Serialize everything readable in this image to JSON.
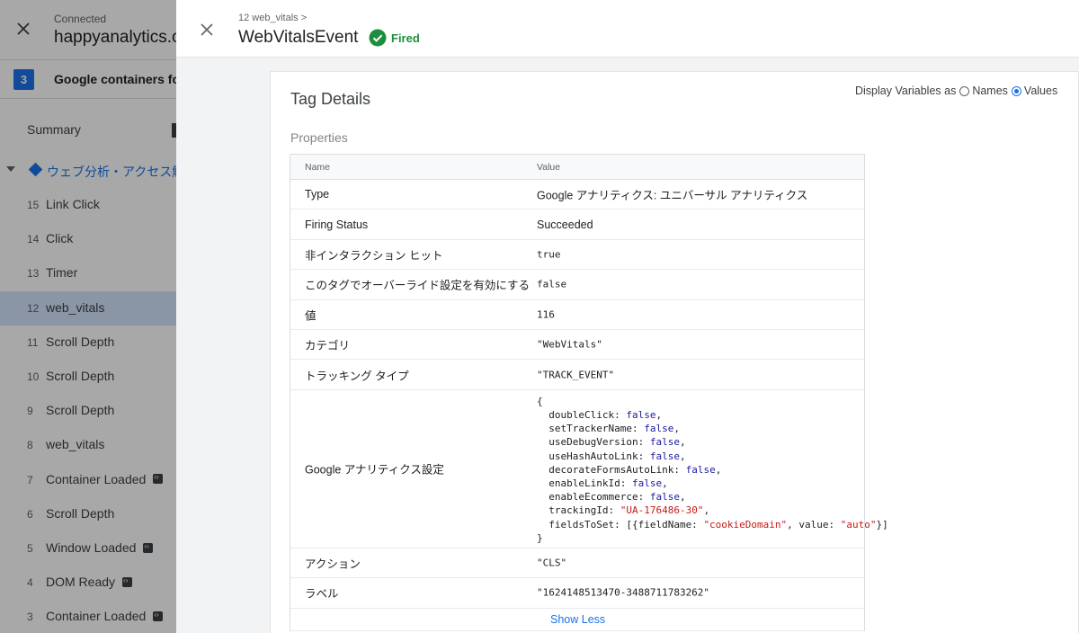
{
  "background": {
    "connected_label": "Connected",
    "site": "happyanalytics.c",
    "container_count": "3",
    "container_label": "Google containers fo",
    "summary_label": "Summary",
    "page_label": "ウェブ分析・アクセス解",
    "events": [
      {
        "num": "15",
        "label": "Link Click",
        "code": false,
        "selected": false
      },
      {
        "num": "14",
        "label": "Click",
        "code": false,
        "selected": false
      },
      {
        "num": "13",
        "label": "Timer",
        "code": false,
        "selected": false
      },
      {
        "num": "12",
        "label": "web_vitals",
        "code": false,
        "selected": true
      },
      {
        "num": "11",
        "label": "Scroll Depth",
        "code": false,
        "selected": false
      },
      {
        "num": "10",
        "label": "Scroll Depth",
        "code": false,
        "selected": false
      },
      {
        "num": "9",
        "label": "Scroll Depth",
        "code": false,
        "selected": false
      },
      {
        "num": "8",
        "label": "web_vitals",
        "code": false,
        "selected": false
      },
      {
        "num": "7",
        "label": "Container Loaded",
        "code": true,
        "selected": false
      },
      {
        "num": "6",
        "label": "Scroll Depth",
        "code": false,
        "selected": false
      },
      {
        "num": "5",
        "label": "Window Loaded",
        "code": true,
        "selected": false
      },
      {
        "num": "4",
        "label": "DOM Ready",
        "code": true,
        "selected": false
      },
      {
        "num": "3",
        "label": "Container Loaded",
        "code": true,
        "selected": false
      }
    ]
  },
  "panel": {
    "breadcrumb": "12 web_vitals >",
    "title": "WebVitalsEvent",
    "status": "Fired",
    "status_color": "#1e8e3e",
    "accent_color": "#1a73e8"
  },
  "tag_details": {
    "title": "Tag Details",
    "display_label": "Display Variables as",
    "option_names": "Names",
    "option_values": "Values",
    "selected_option": "Values",
    "section_label": "Properties",
    "col_name": "Name",
    "col_value": "Value",
    "rows": [
      {
        "name": "Type",
        "value": "Google アナリティクス: ユニバーサル アナリティクス"
      },
      {
        "name": "Firing Status",
        "value": "Succeeded"
      },
      {
        "name": "非インタラクション ヒット",
        "value": "true"
      },
      {
        "name": "このタグでオーバーライド設定を有効にする",
        "value": "false"
      },
      {
        "name": "値",
        "value": "116"
      },
      {
        "name": "カテゴリ",
        "value": "\"WebVitals\""
      },
      {
        "name": "トラッキング タイプ",
        "value": "\"TRACK_EVENT\""
      },
      {
        "name": "Google アナリティクス設定",
        "value_lines": [
          "{",
          "  doubleClick: false,",
          "  setTrackerName: false,",
          "  useDebugVersion: false,",
          "  useHashAutoLink: false,",
          "  decorateFormsAutoLink: false,",
          "  enableLinkId: false,",
          "  enableEcommerce: false,",
          "  trackingId: \"UA-176486-30\",",
          "  fieldsToSet: [{fieldName: \"cookieDomain\", value: \"auto\"}]",
          "}"
        ]
      },
      {
        "name": "アクション",
        "value": "\"CLS\""
      },
      {
        "name": "ラベル",
        "value": "\"1624148513470-3488711783262\""
      }
    ],
    "show_less": "Show Less"
  }
}
